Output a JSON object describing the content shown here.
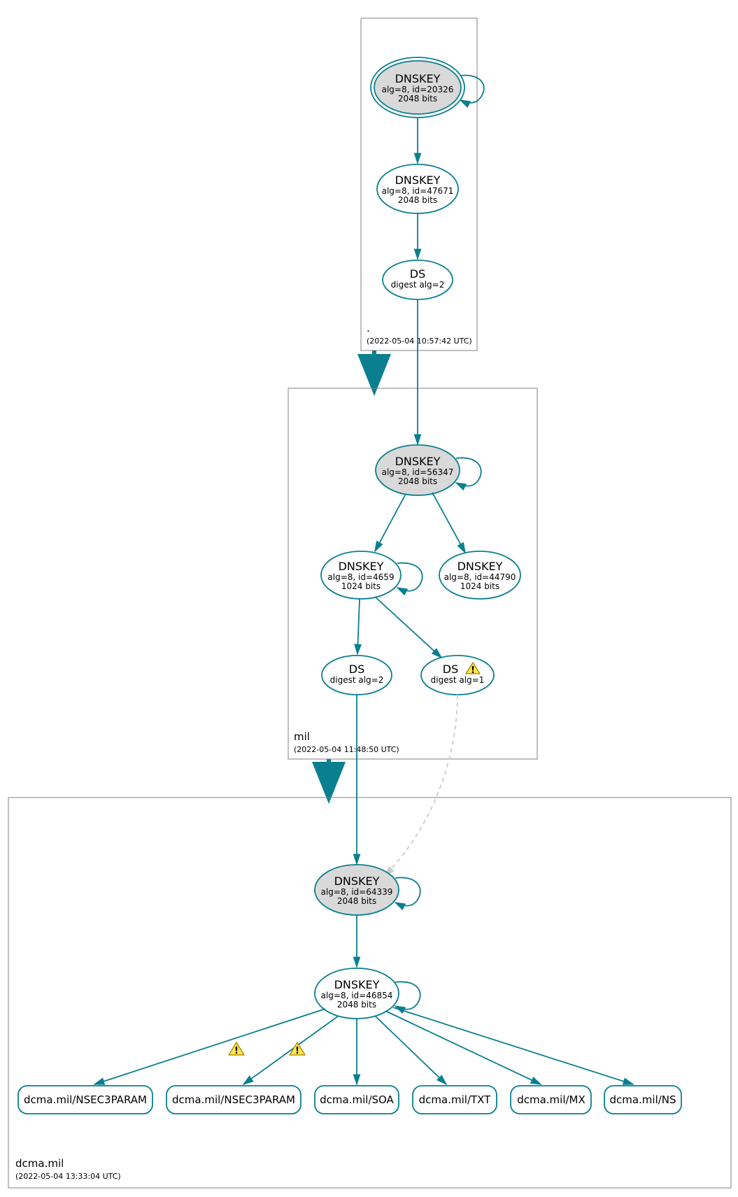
{
  "zones": {
    "root": {
      "label": ".",
      "timestamp": "(2022-05-04 10:57:42 UTC)"
    },
    "mil": {
      "label": "mil",
      "timestamp": "(2022-05-04 11:48:50 UTC)"
    },
    "dcma": {
      "label": "dcma.mil",
      "timestamp": "(2022-05-04 13:33:04 UTC)"
    }
  },
  "nodes": {
    "root_ksk": {
      "title": "DNSKEY",
      "line2": "alg=8, id=20326",
      "line3": "2048 bits"
    },
    "root_zsk": {
      "title": "DNSKEY",
      "line2": "alg=8, id=47671",
      "line3": "2048 bits"
    },
    "root_ds": {
      "title": "DS",
      "line2": "digest alg=2"
    },
    "mil_ksk": {
      "title": "DNSKEY",
      "line2": "alg=8, id=56347",
      "line3": "2048 bits"
    },
    "mil_zsk1": {
      "title": "DNSKEY",
      "line2": "alg=8, id=4659",
      "line3": "1024 bits"
    },
    "mil_zsk2": {
      "title": "DNSKEY",
      "line2": "alg=8, id=44790",
      "line3": "1024 bits"
    },
    "mil_ds1": {
      "title": "DS",
      "line2": "digest alg=2"
    },
    "mil_ds2": {
      "title": "DS",
      "line2": "digest alg=1"
    },
    "dcma_ksk": {
      "title": "DNSKEY",
      "line2": "alg=8, id=64339",
      "line3": "2048 bits"
    },
    "dcma_zsk": {
      "title": "DNSKEY",
      "line2": "alg=8, id=46854",
      "line3": "2048 bits"
    }
  },
  "rrsets": {
    "r1": "dcma.mil/NSEC3PARAM",
    "r2": "dcma.mil/NSEC3PARAM",
    "r3": "dcma.mil/SOA",
    "r4": "dcma.mil/TXT",
    "r5": "dcma.mil/MX",
    "r6": "dcma.mil/NS"
  },
  "colors": {
    "stroke": "#0a7f8f",
    "fill_gray": "#d9d9d9",
    "box": "#808080"
  }
}
